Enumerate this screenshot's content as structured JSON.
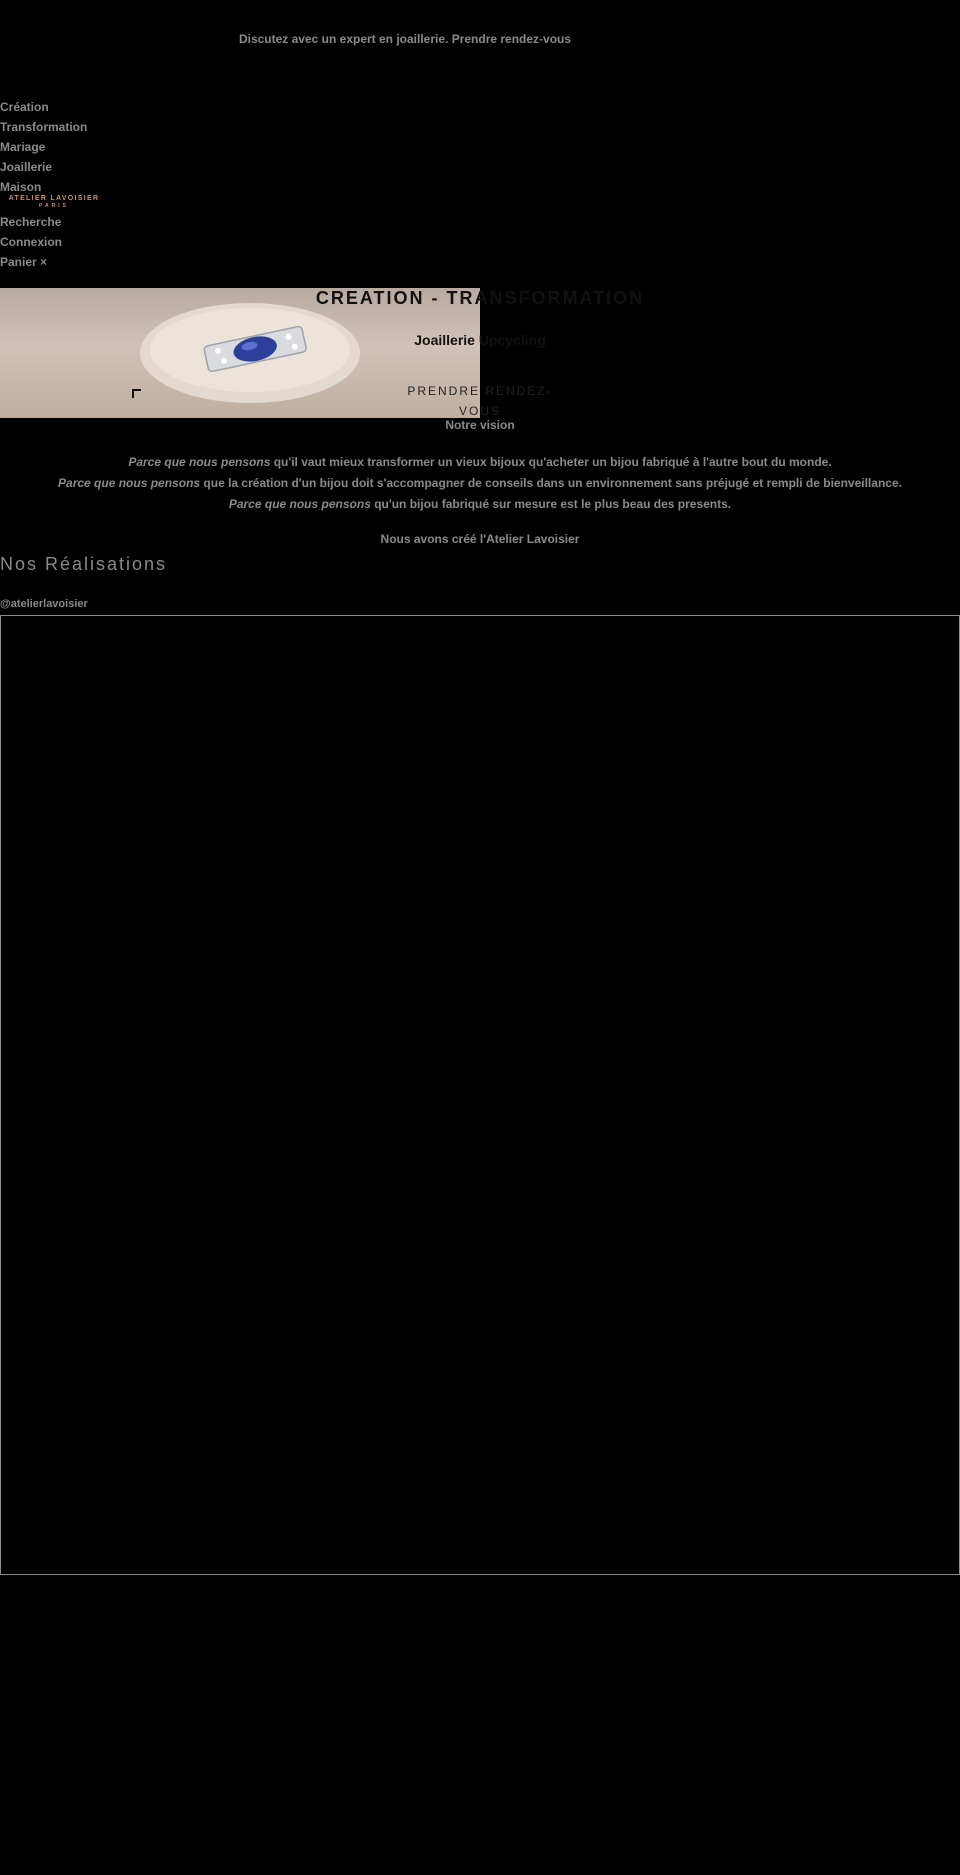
{
  "announcement": "Discutez avec un expert en joaillerie.  Prendre rendez-vous",
  "nav": {
    "items": [
      "Création",
      "Transformation",
      "Mariage",
      "Joaillerie",
      "Maison"
    ],
    "utility": [
      "Recherche",
      "Connexion",
      "Panier ×"
    ]
  },
  "logo": {
    "main": "ATELIER LAVOISIER",
    "sub": "PARIS"
  },
  "hero": {
    "title": "CREATION - TRANSFORMATION",
    "subtitle": "Joaillerie Upcycling",
    "cta": "PRENDRE RENDEZ-VOUS",
    "cta_note": "Notre vision"
  },
  "values": {
    "lines": [
      {
        "lead": "Parce que nous pensons",
        "rest": " qu'il vaut mieux transformer un vieux bijoux qu'acheter un bijou fabriqué à l'autre bout du monde."
      },
      {
        "lead": "Parce que nous pensons",
        "rest": " que la création d'un bijou doit s'accompagner de conseils dans un environnement sans préjugé et rempli de bienveillance."
      },
      {
        "lead": "Parce que nous pensons",
        "rest": " qu'un bijou fabriqué sur mesure est le plus beau des presents."
      }
    ],
    "closing": "Nous avons créé l'Atelier Lavoisier"
  },
  "realisations": {
    "title": "Nos Réalisations",
    "handle": "@atelierlavoisier"
  },
  "colors": {
    "background": "#000000",
    "text": "#8a8a8a",
    "logo": "#c8926a",
    "gem": "#2c3f9a"
  }
}
